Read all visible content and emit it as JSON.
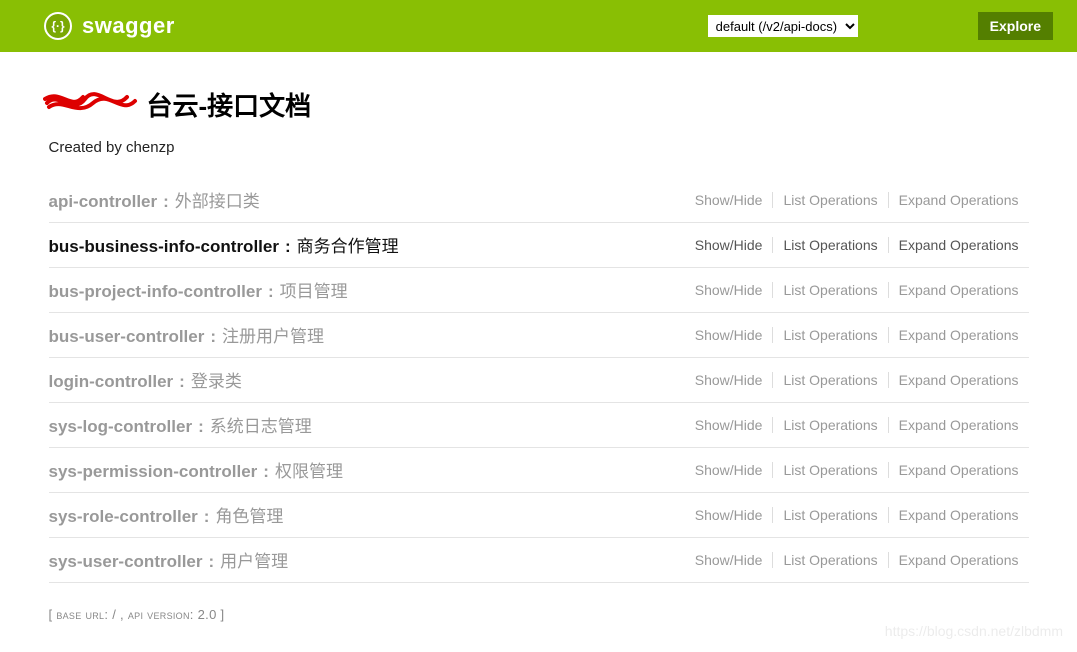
{
  "brand": {
    "logo_glyph": "{·}",
    "name": "swagger"
  },
  "topbar": {
    "api_select_value": "default (/v2/api-docs)",
    "explore_label": "Explore"
  },
  "page": {
    "title_suffix": "台云-接口文档",
    "subtitle": "Created by chenzp"
  },
  "op_labels": {
    "show_hide": "Show/Hide",
    "list": "List Operations",
    "expand": "Expand Operations"
  },
  "resources": [
    {
      "name": "api-controller",
      "desc": "外部接口类",
      "active": false
    },
    {
      "name": "bus-business-info-controller",
      "desc": "商务合作管理",
      "active": true
    },
    {
      "name": "bus-project-info-controller",
      "desc": "项目管理",
      "active": false
    },
    {
      "name": "bus-user-controller",
      "desc": "注册用户管理",
      "active": false
    },
    {
      "name": "login-controller",
      "desc": "登录类",
      "active": false
    },
    {
      "name": "sys-log-controller",
      "desc": "系统日志管理",
      "active": false
    },
    {
      "name": "sys-permission-controller",
      "desc": "权限管理",
      "active": false
    },
    {
      "name": "sys-role-controller",
      "desc": "角色管理",
      "active": false
    },
    {
      "name": "sys-user-controller",
      "desc": "用户管理",
      "active": false
    }
  ],
  "footer": {
    "base_url_label": "base url",
    "base_url_value": "/",
    "api_version_label": "api version",
    "api_version_value": "2.0"
  },
  "watermark": "https://blog.csdn.net/zlbdmm"
}
